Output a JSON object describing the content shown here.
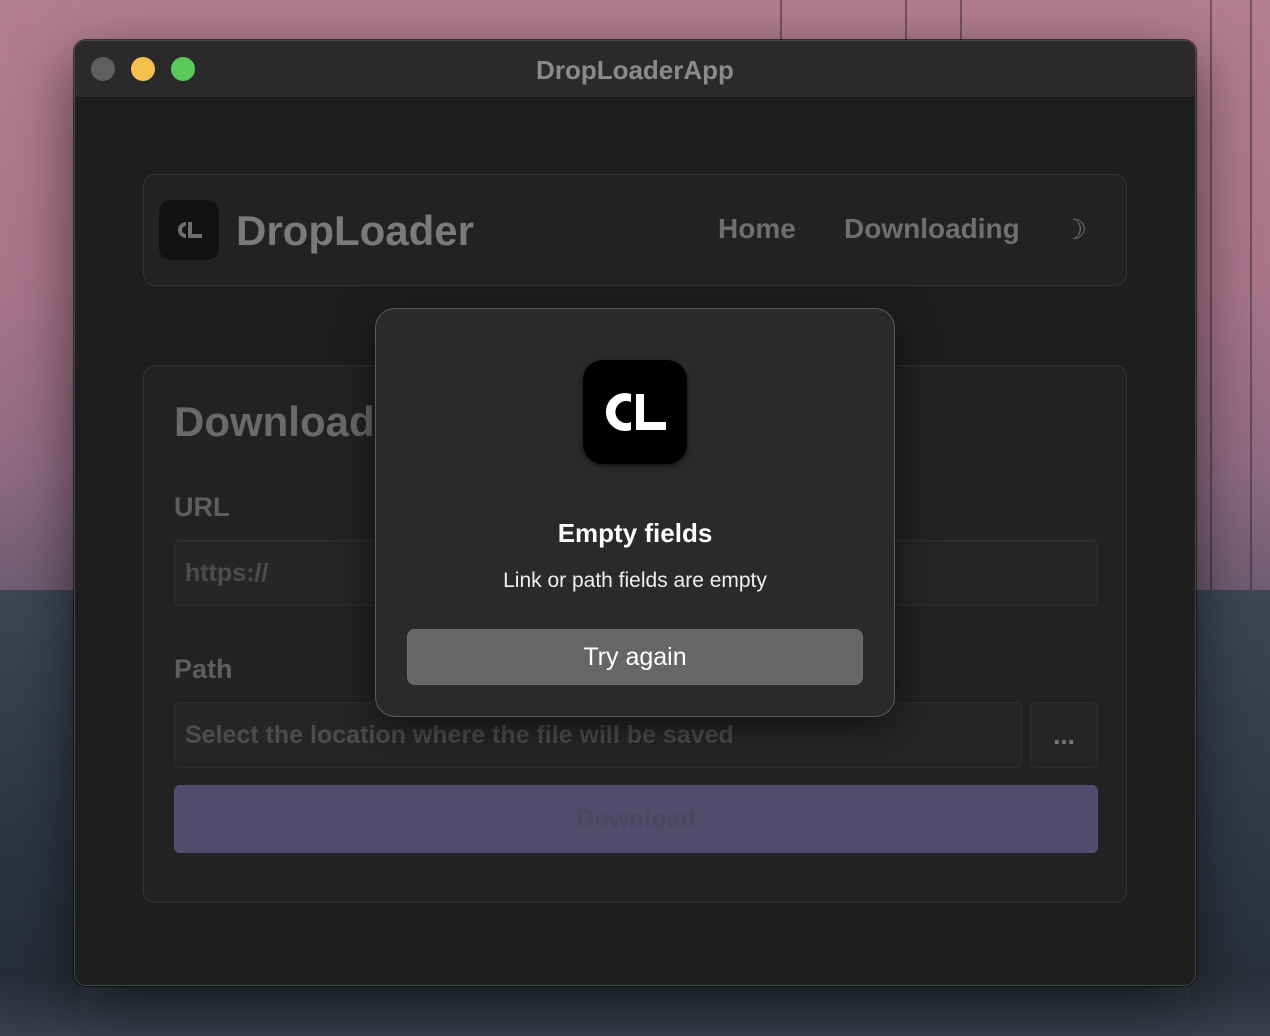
{
  "window": {
    "title": "DropLoaderApp"
  },
  "header": {
    "logo_text": "ᑕL",
    "brand": "DropLoader",
    "nav": [
      {
        "label": "Home"
      },
      {
        "label": "Downloading"
      }
    ],
    "theme_icon": "☽"
  },
  "form": {
    "title": "Download",
    "url_label": "URL",
    "url_placeholder": "https://",
    "path_label": "Path",
    "path_placeholder": "Select the location where the file will be saved",
    "browse_label": "...",
    "download_label": "Download"
  },
  "alert": {
    "icon": "droploader-logo-icon",
    "title": "Empty fields",
    "message": "Link or path fields are empty",
    "button_label": "Try again"
  },
  "colors": {
    "window_bg": "#1e1e1e",
    "accent": "#524c6c",
    "alert_bg": "#2b2a2a",
    "alert_button": "#666666"
  }
}
